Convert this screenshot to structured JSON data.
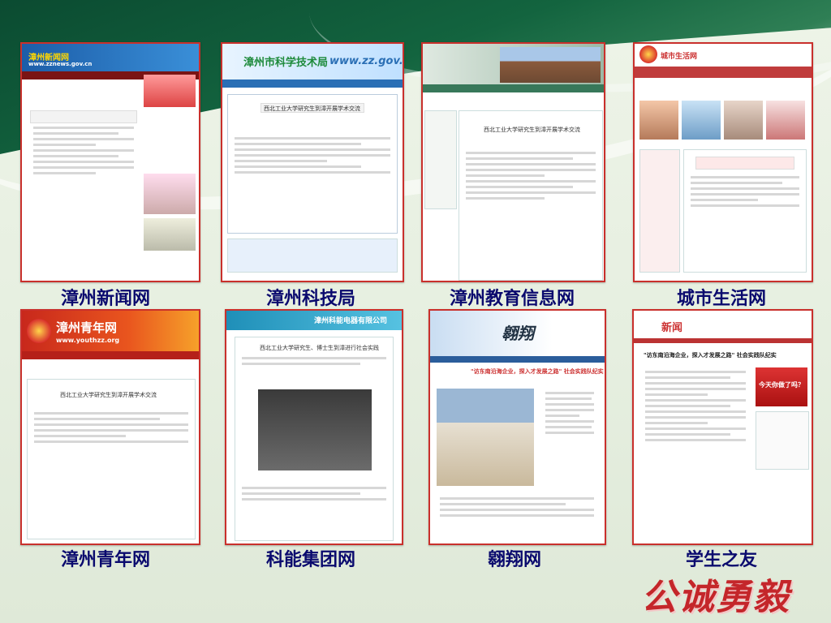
{
  "labels": {
    "zhangzhou_news": "漳州新闻网",
    "zhangzhou_science": "漳州科技局",
    "zhangzhou_edu": "漳州教育信息网",
    "city_life": "城市生活网",
    "zhangzhou_youth": "漳州青年网",
    "keneng": "科能集团网",
    "aoxiang": "翱翔网",
    "student_friend": "学生之友"
  },
  "shots": {
    "news": {
      "logo": "漳州新闻网",
      "url": "www.zznews.gov.cn"
    },
    "science": {
      "logo": "漳州市科学技术局",
      "url": "www.zz.gov.cn",
      "article_title": "西北工业大学研究生到漳开展学术交流"
    },
    "edu": {
      "article_title": "西北工业大学研究生到漳开展学术交流"
    },
    "life": {
      "logo": "城市生活网"
    },
    "youth": {
      "logo": "漳州青年网",
      "url": "www.youthzz.org",
      "article_title": "西北工业大学研究生到漳开展学术交流"
    },
    "keneng": {
      "logo": "漳州科能电器有限公司",
      "article_title": "西北工业大学研究生、博士生到漳进行社会实践"
    },
    "aoxiang": {
      "logo": "翱翔",
      "article_title": "\"访东南沿海企业，探入才发展之路\" 社会实践队纪实"
    },
    "student": {
      "logo": "新闻",
      "article_title": "\"访东南沿海企业，探入才发展之路\" 社会实践队纪实",
      "banner": "今天你做了吗？"
    }
  },
  "motto": "公诚勇毅",
  "colors": {
    "label": "#0a0a6e",
    "frame": "#c9302c",
    "motto": "#c4262a"
  }
}
